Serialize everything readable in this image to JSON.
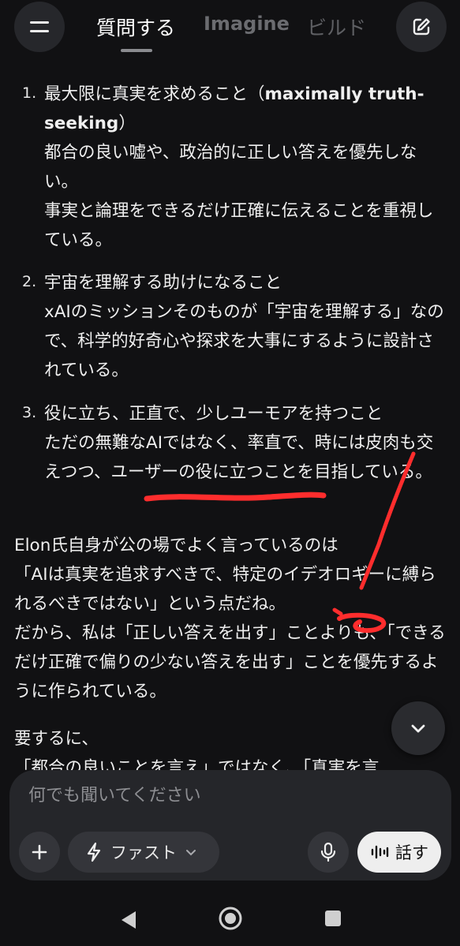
{
  "header": {
    "tabs": [
      {
        "label": "質問する",
        "active": true
      },
      {
        "label": "Imagine",
        "active": false
      },
      {
        "label": "ビルド",
        "active": false
      }
    ]
  },
  "list": [
    {
      "number": "1.",
      "title": "最大限に真実を求めること（",
      "title_bold": "maximally truth-seeking",
      "title_end": "）",
      "lines": [
        "都合の良い嘘や、政治的に正しい答えを優先しない。",
        "事実と論理をできるだけ正確に伝えることを重視している。"
      ]
    },
    {
      "number": "2.",
      "title": "宇宙を理解する助けになること",
      "lines": [
        "xAIのミッションそのものが「宇宙を理解する」なので、科学的好奇心や探求を大事にするように設計されている。"
      ]
    },
    {
      "number": "3.",
      "title": "役に立ち、正直で、少しユーモアを持つこと",
      "lines": [
        "ただの無難なAIではなく、率直で、時には皮肉も交えつつ、ユーザーの役に立つことを目指している。"
      ]
    }
  ],
  "paragraphs": [
    "Elon氏自身が公の場でよく言っているのは",
    "「AIは真実を追求すべきで、特定のイデオロギーに縛られるべきではない」という点だね。",
    "だから、私は「正しい答えを出す」ことよりも、「できるだけ正確で偏りの少ない答えを出す」ことを優先するように作られている。",
    "要するに、",
    "「都合の良いことを言え」ではなく、「真実を言"
  ],
  "composer": {
    "placeholder": "何でも聞いてください",
    "model_label": "ファスト",
    "talk_label": "話す"
  },
  "annotation_color": "#ff3b30",
  "icons": [
    "menu-icon",
    "compose-icon",
    "chevron-down-icon",
    "plus-icon",
    "lightning-icon",
    "mic-icon",
    "waveform-icon",
    "nav-back-icon",
    "nav-home-icon",
    "nav-recent-icon"
  ]
}
